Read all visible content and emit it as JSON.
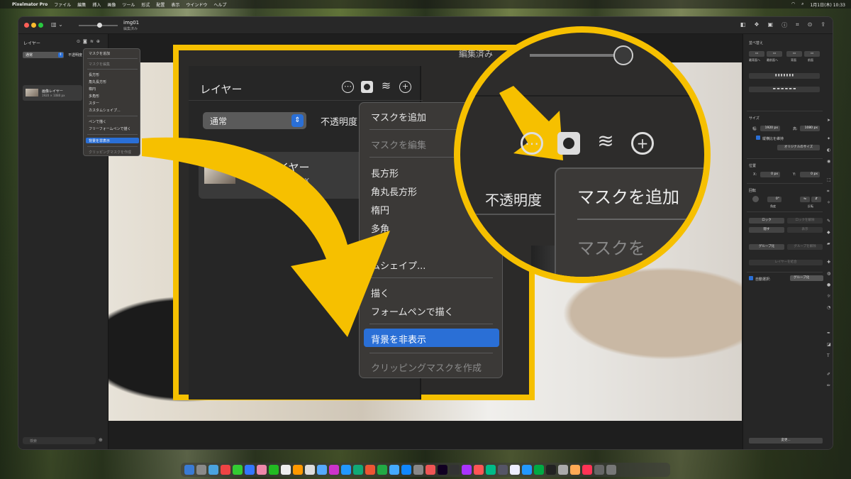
{
  "menubar": {
    "app": "Pixelmator Pro",
    "items": [
      "ファイル",
      "編集",
      "挿入",
      "画像",
      "ツール",
      "形式",
      "配置",
      "表示",
      "ウインドウ",
      "ヘルプ"
    ],
    "clock": "1月1日(木) 10:33"
  },
  "window": {
    "doc_title": "img01",
    "doc_subtitle": "編集済み"
  },
  "left_panel": {
    "title": "レイヤー",
    "blend_mode": "通常",
    "opacity_label": "不透明度",
    "layer_name": "画像レイヤー",
    "layer_size": "1920 × 1080 px",
    "search_placeholder": "検索"
  },
  "small_menu": {
    "add_mask": "マスクを追加",
    "edit_mask": "マスクを編集",
    "rect": "長方形",
    "rounded_rect": "角丸長方形",
    "ellipse": "楕円",
    "polygon": "多角形",
    "star": "スター",
    "custom_shape": "カスタムシェイプ...",
    "pen": "ペンで描く",
    "freeform_pen": "フリーフォームペンで描く",
    "hide_background": "背景を非表示",
    "clipping_mask": "クリッピングマスクを作成"
  },
  "zoom_panel": {
    "title": "レイヤー",
    "blend_mode": "通常",
    "opacity_label": "不透明度",
    "layer_name": "イヤー",
    "layer_size": "0 px",
    "top_text": "編集済み"
  },
  "big_menu": {
    "add_mask": "マスクを追加",
    "edit_mask": "マスクを編集",
    "rect": "長方形",
    "rounded_rect": "角丸長方形",
    "ellipse": "楕円",
    "polygon": "多角",
    "custom_shape": "ムシェイプ...",
    "pen": "描く",
    "freeform_pen": "フォームペンで描く",
    "hide_background": "背景を非表示",
    "clipping_mask": "クリッピングマスクを作成"
  },
  "circle": {
    "opacity_label": "不透明度",
    "add_mask": "マスクを追加",
    "edit_mask": "マスクを"
  },
  "right_panel": {
    "arrange": "並べ替え",
    "arrange_btns": [
      "最背面へ",
      "最前面へ",
      "背面",
      "前面"
    ],
    "size": "サイズ",
    "width_label": "幅:",
    "width": "1920 px",
    "height_label": "高:",
    "height": "1080 px",
    "keep_ratio": "縦横比を維持",
    "original_size": "オリジナルのサイズ",
    "position": "位置",
    "x_label": "X:",
    "x": "0 px",
    "y_label": "Y:",
    "y": "0 px",
    "rotate": "回転",
    "angle": "0°",
    "angle_label": "角度",
    "flip_label": "反転",
    "lock": "ロック",
    "unlock": "ロックを解除",
    "hide": "隠す",
    "show": "表示",
    "group": "グループ化",
    "ungroup": "グループを解除",
    "merge": "レイヤーを結合",
    "auto_select": "自動選択:",
    "auto_select_value": "グループ化",
    "change": "変更..."
  },
  "colors": {
    "accent": "#2a6fd6",
    "highlight": "#f6c000"
  }
}
